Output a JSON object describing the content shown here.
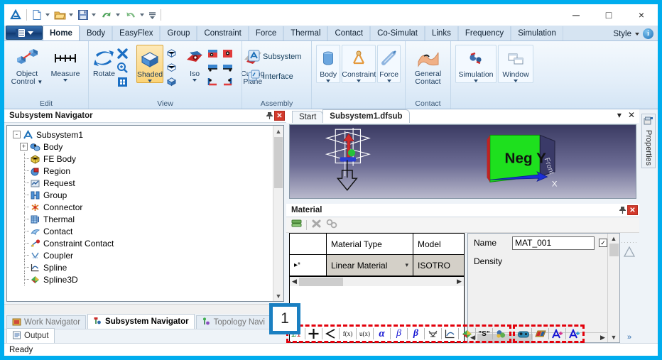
{
  "window": {
    "minimize_label": "─",
    "maximize_label": "□",
    "close_label": "×"
  },
  "quick_access": {
    "app_icon": "app-logo-icon",
    "items": [
      {
        "name": "new-document-icon",
        "has_caret": true
      },
      {
        "name": "open-folder-icon",
        "has_caret": true
      },
      {
        "name": "save-icon",
        "has_caret": true
      },
      {
        "name": "undo-icon",
        "has_caret": true
      },
      {
        "name": "redo-icon",
        "has_caret": true
      },
      {
        "name": "customize-quick-access-icon",
        "has_caret": false
      }
    ]
  },
  "ribbon": {
    "app_menu_label": "",
    "tabs": [
      {
        "label": "Home",
        "active": true
      },
      {
        "label": "Body",
        "active": false
      },
      {
        "label": "EasyFlex",
        "active": false
      },
      {
        "label": "Group",
        "active": false
      },
      {
        "label": "Constraint",
        "active": false
      },
      {
        "label": "Force",
        "active": false
      },
      {
        "label": "Thermal",
        "active": false
      },
      {
        "label": "Contact",
        "active": false
      },
      {
        "label": "Co-Simulat",
        "active": false
      },
      {
        "label": "Links",
        "active": false
      },
      {
        "label": "Frequency",
        "active": false
      },
      {
        "label": "Simulation",
        "active": false
      }
    ],
    "style_label": "Style",
    "help_label": "i",
    "groups": [
      {
        "title": "Edit",
        "buttons": [
          {
            "label": "Object\nControl",
            "icon": "object-control-icon",
            "caret": true
          },
          {
            "label": "Measure",
            "icon": "measure-icon",
            "caret": true
          }
        ]
      },
      {
        "title": "View",
        "buttons": [
          {
            "label": "Rotate",
            "icon": "rotate-icon",
            "caret": false
          },
          {
            "label": "Shaded",
            "icon": "shaded-cube-icon",
            "caret": true,
            "selected": true
          },
          {
            "label": "Iso",
            "icon": "iso-view-icon",
            "caret": true
          },
          {
            "label": "Cutting\nPlane",
            "icon": "cutting-plane-icon",
            "caret": false
          }
        ]
      },
      {
        "title": "Assembly",
        "buttons": [
          {
            "label": "Subsystem",
            "icon": "subsystem-icon"
          },
          {
            "label": "Interface",
            "icon": "interface-icon"
          }
        ]
      },
      {
        "title": "",
        "buttons": [
          {
            "label": "Body",
            "icon": "body-cylinder-icon",
            "caret": true
          },
          {
            "label": "Constraint",
            "icon": "constraint-icon",
            "caret": true
          },
          {
            "label": "Force",
            "icon": "force-icon",
            "caret": true
          }
        ]
      },
      {
        "title": "Contact",
        "buttons": [
          {
            "label": "General\nContact",
            "icon": "general-contact-icon",
            "caret": false
          }
        ]
      },
      {
        "title": "",
        "buttons": [
          {
            "label": "Simulation",
            "icon": "simulation-icon",
            "caret": true
          },
          {
            "label": "Window",
            "icon": "window-icon",
            "caret": true
          }
        ]
      }
    ]
  },
  "navigator": {
    "title": "Subsystem Navigator",
    "pin_icon": "pin-icon",
    "close_icon": "close-icon",
    "tree": {
      "root": {
        "label": "Subsystem1",
        "icon": "subsystem-root-icon",
        "expander": "-"
      },
      "children": [
        {
          "label": "Body",
          "icon": "body-icon",
          "expander": "+"
        },
        {
          "label": "FE Body",
          "icon": "fe-body-icon",
          "expander": ""
        },
        {
          "label": "Region",
          "icon": "region-icon",
          "expander": ""
        },
        {
          "label": "Request",
          "icon": "request-icon",
          "expander": ""
        },
        {
          "label": "Group",
          "icon": "group-icon",
          "expander": ""
        },
        {
          "label": "Connector",
          "icon": "connector-icon",
          "expander": ""
        },
        {
          "label": "Thermal",
          "icon": "thermal-icon",
          "expander": ""
        },
        {
          "label": "Contact",
          "icon": "contact-icon",
          "expander": ""
        },
        {
          "label": "Constraint Contact",
          "icon": "constraint-contact-icon",
          "expander": ""
        },
        {
          "label": "Coupler",
          "icon": "coupler-icon",
          "expander": ""
        },
        {
          "label": "Spline",
          "icon": "spline-icon",
          "expander": ""
        },
        {
          "label": "Spline3D",
          "icon": "spline3d-icon",
          "expander": ""
        }
      ]
    },
    "dock_tabs": [
      {
        "label": "Work Navigator",
        "icon": "work-navigator-icon",
        "active": false
      },
      {
        "label": "Subsystem Navigator",
        "icon": "subsystem-navigator-icon",
        "active": true
      },
      {
        "label": "Topology Navi",
        "icon": "topology-navigator-icon",
        "active": false
      }
    ],
    "dock_tabs2": [
      {
        "label": "Output",
        "icon": "output-icon",
        "active": true
      }
    ]
  },
  "document": {
    "tabs": [
      {
        "label": "Start",
        "active": false
      },
      {
        "label": "Subsystem1.dfsub",
        "active": true
      }
    ],
    "dropdown_icon": "chevron-down-icon",
    "close_icon": "close-icon",
    "viewport": {
      "face_label": "Neg Y",
      "side_label": "Front",
      "axis_label": "X"
    }
  },
  "material": {
    "title": "Material",
    "pin_icon": "pin-icon",
    "close_icon": "close-icon",
    "toolbar": [
      {
        "name": "save-material-icon"
      },
      {
        "name": "delete-material-icon"
      },
      {
        "name": "copy-material-icon"
      }
    ],
    "grid": {
      "columns": [
        "",
        "Material Type",
        "Model"
      ],
      "rows": [
        {
          "marker": "▸*",
          "material_type": "Linear Material",
          "model": "ISOTRO"
        }
      ]
    },
    "properties": [
      {
        "label": "Name",
        "value": "MAT_001",
        "has_input": true,
        "has_checkbox": true
      },
      {
        "label": "Density",
        "value": "",
        "has_input": false,
        "has_checkbox": false
      }
    ],
    "expand_label": "»"
  },
  "properties_rail": {
    "label": "Properties",
    "icon": "properties-icon"
  },
  "bottom_toolbar": {
    "highlighted": true,
    "highlight_color": "#e3000b",
    "groups": [
      {
        "icons": [
          {
            "name": "integer-value-icon",
            "glyph": "1.1"
          },
          {
            "name": "add-plus-icon",
            "glyph": "+"
          },
          {
            "name": "angle-icon",
            "glyph": "∠"
          },
          {
            "name": "function-fx-icon",
            "glyph": "f(x)"
          },
          {
            "name": "function-ux-icon",
            "glyph": "u(x)"
          },
          {
            "name": "alpha-icon",
            "glyph": "α"
          },
          {
            "name": "beta-italic-icon",
            "glyph": "β"
          },
          {
            "name": "beta-bold-icon",
            "glyph": "β"
          },
          {
            "name": "matrix-icon",
            "glyph": "ℵ"
          },
          {
            "name": "curve-icon",
            "glyph": "⤵"
          },
          {
            "name": "spline3d-icon",
            "glyph": "◆"
          },
          {
            "name": "string-icon",
            "glyph": "\"S\""
          },
          {
            "name": "material-icon",
            "glyph": "⚙"
          }
        ]
      },
      {
        "icons": [
          {
            "name": "joystick-icon",
            "glyph": "⌘"
          },
          {
            "name": "color-palette-icon",
            "glyph": "▤"
          },
          {
            "name": "add-variable-icon",
            "glyph": "A+"
          },
          {
            "name": "add-variable-alt-icon",
            "glyph": "A+"
          }
        ]
      }
    ]
  },
  "callout": {
    "number": "1"
  },
  "statusbar": {
    "text": "Ready"
  }
}
